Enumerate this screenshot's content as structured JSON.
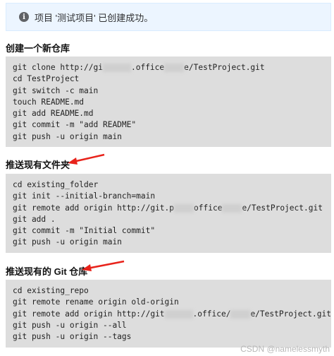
{
  "alert": {
    "text": "项目 '测试项目' 已创建成功。"
  },
  "sections": [
    {
      "title": "创建一个新仓库",
      "lines": [
        {
          "pre": "git clone http://gi",
          "post": ".office",
          "post2": "e/TestProject.git"
        },
        {
          "text": "cd TestProject"
        },
        {
          "text": "git switch -c main"
        },
        {
          "text": "touch README.md"
        },
        {
          "text": "git add README.md"
        },
        {
          "text": "git commit -m \"add README\""
        },
        {
          "text": "git push -u origin main"
        }
      ]
    },
    {
      "title": "推送现有文件夹",
      "lines": [
        {
          "text": "cd existing_folder"
        },
        {
          "text": "git init --initial-branch=main"
        },
        {
          "pre": "git remote add origin http://git.p",
          "post": "office",
          "post2": "e/TestProject.git"
        },
        {
          "text": "git add ."
        },
        {
          "text": "git commit -m \"Initial commit\""
        },
        {
          "text": "git push -u origin main"
        }
      ]
    },
    {
      "title": "推送现有的 Git 仓库",
      "lines": [
        {
          "text": "cd existing_repo"
        },
        {
          "text": "git remote rename origin old-origin"
        },
        {
          "pre": "git remote add origin http://git",
          "post": ".office/",
          "post2": "e/TestProject.git"
        },
        {
          "text": "git push -u origin --all"
        },
        {
          "text": "git push -u origin --tags"
        }
      ]
    }
  ],
  "watermark": "CSDN @namelessmyth",
  "colors": {
    "arrow": "#e8231b",
    "alert_bg": "#ecf5ff",
    "code_bg": "#dddddd"
  }
}
